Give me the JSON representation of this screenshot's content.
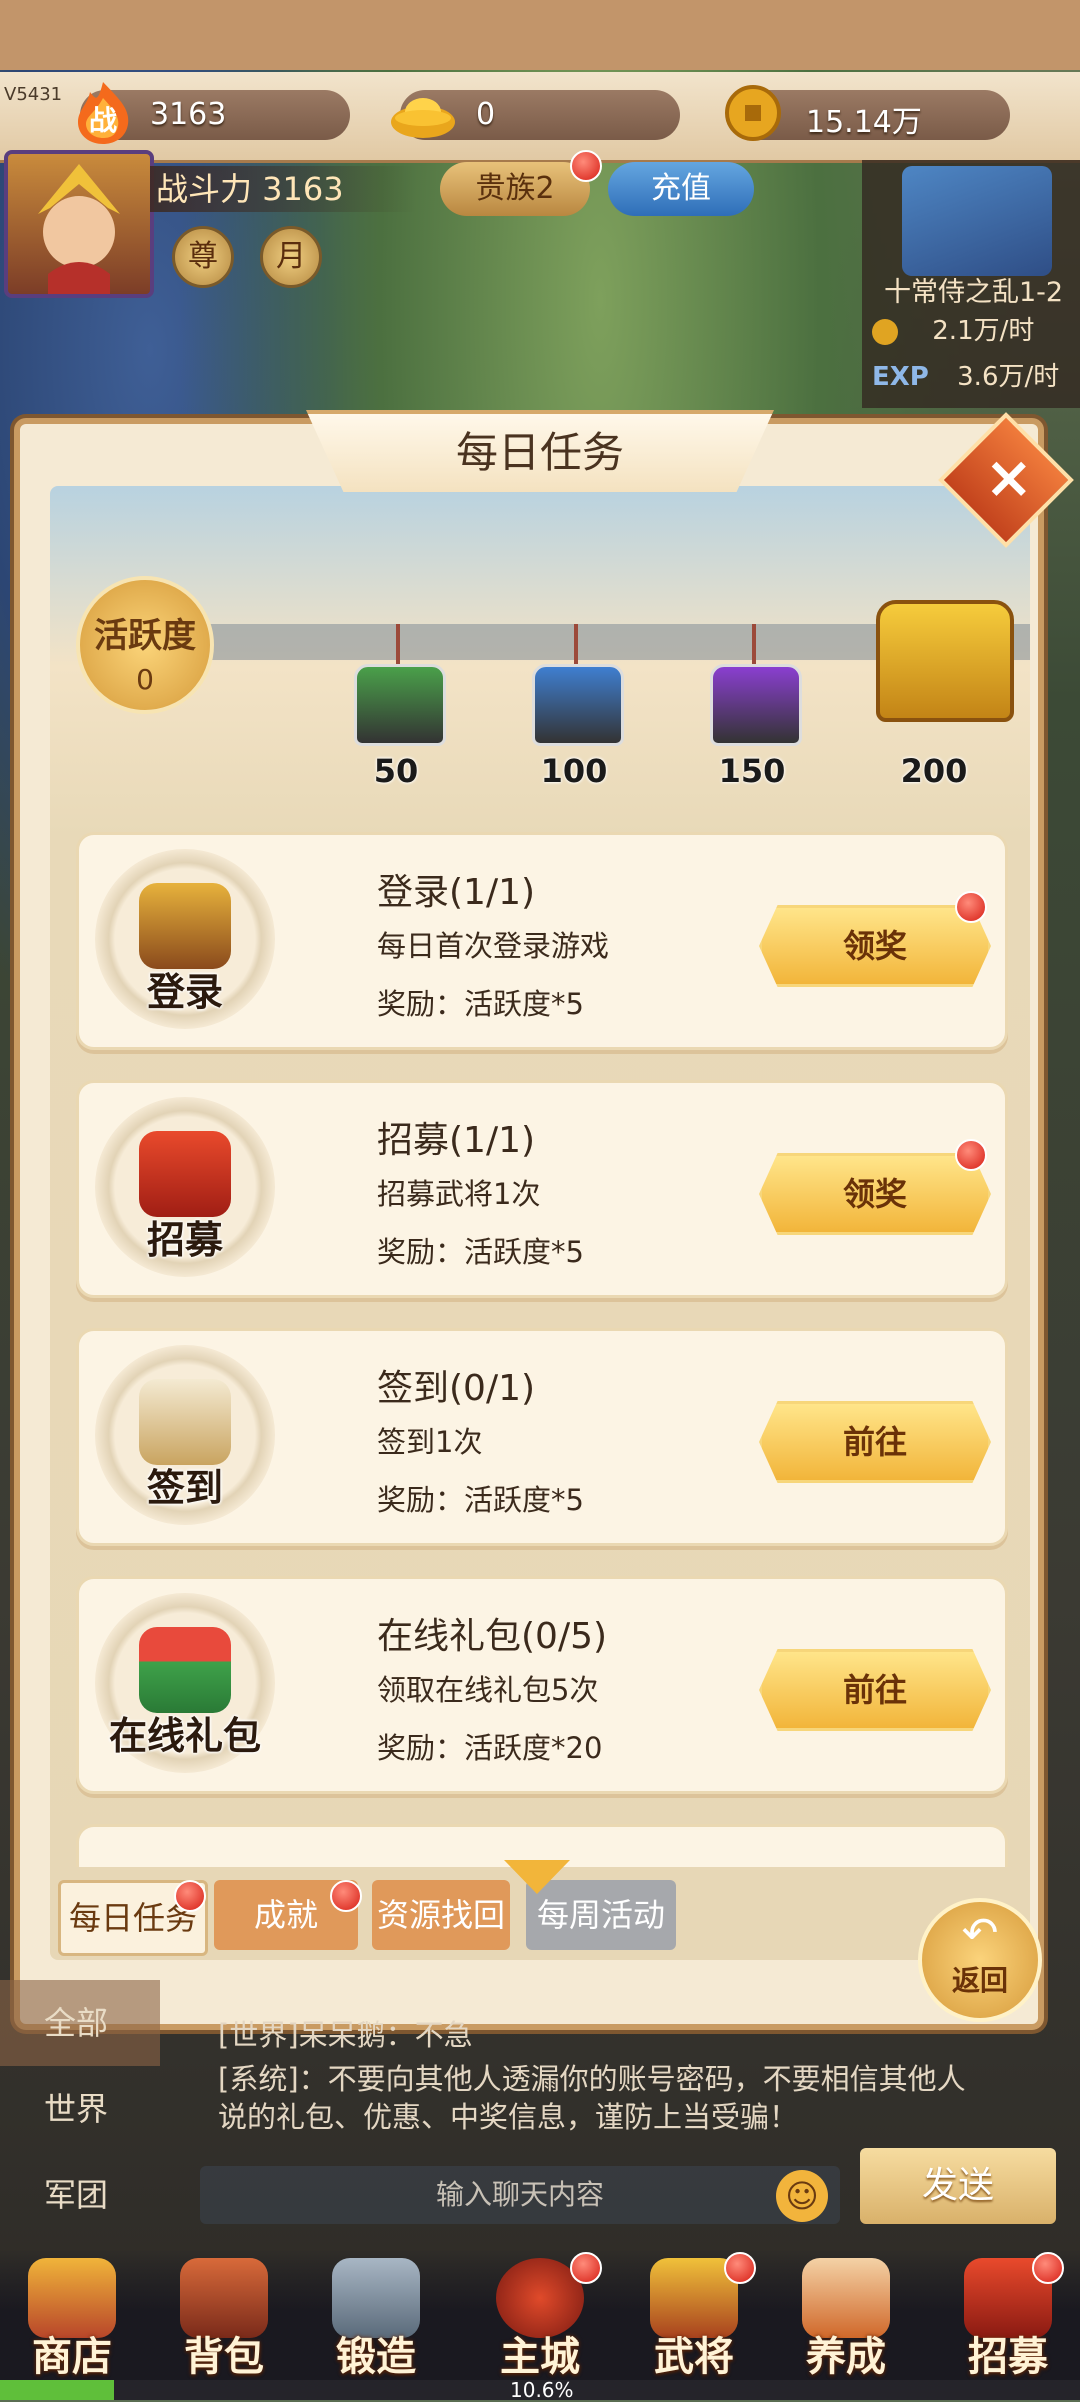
{
  "version": "V5431",
  "resources": {
    "power_icon_text": "战",
    "power": "3163",
    "gold_ingot": "0",
    "copper": "15.14万"
  },
  "player": {
    "combat_power": "战斗力 3163",
    "vip": "贵族2",
    "recharge": "充值",
    "btn_zun": "尊",
    "btn_yue": "月"
  },
  "stage": {
    "name": "十常侍之乱1-2",
    "coin_rate": "2.1万/时",
    "exp_label": "EXP",
    "exp_rate": "3.6万/时"
  },
  "popup": {
    "title": "每日任务",
    "close_label": "×",
    "activity_label": "活跃度",
    "activity_value": "0",
    "activity_progress": 0,
    "chests": [
      {
        "value": "50",
        "color": "#4aa04a"
      },
      {
        "value": "100",
        "color": "#3f7fd0"
      },
      {
        "value": "150",
        "color": "#8a3fd0"
      },
      {
        "value": "200",
        "color": "#e0a822"
      }
    ],
    "tasks": [
      {
        "icon_caption": "登录",
        "title": "登录(1/1)",
        "desc": "每日首次登录游戏",
        "reward": "奖励：活跃度*5",
        "button": "领奖",
        "has_dot": true
      },
      {
        "icon_caption": "招募",
        "title": "招募(1/1)",
        "desc": "招募武将1次",
        "reward": "奖励：活跃度*5",
        "button": "领奖",
        "has_dot": true
      },
      {
        "icon_caption": "签到",
        "title": "签到(0/1)",
        "desc": "签到1次",
        "reward": "奖励：活跃度*5",
        "button": "前往",
        "has_dot": false
      },
      {
        "icon_caption": "在线礼包",
        "title": "在线礼包(0/5)",
        "desc": "领取在线礼包5次",
        "reward": "奖励：活跃度*20",
        "button": "前往",
        "has_dot": false
      }
    ],
    "tabs": [
      {
        "label": "每日任务",
        "active": true
      },
      {
        "label": "成就",
        "active": false
      },
      {
        "label": "资源找回",
        "active": false
      },
      {
        "label": "每周活动",
        "active": false
      }
    ],
    "back_label": "返回"
  },
  "chat": {
    "channels": [
      "全部",
      "世界",
      "军团"
    ],
    "messages": [
      "[世界]呆呆鹅：不急",
      "[系统]：不要向其他人透漏你的账号密码，不要相信其他人说的礼包、优惠、中奖信息，谨防上当受骗！"
    ],
    "input_placeholder": "输入聊天内容",
    "send_label": "发送"
  },
  "nav": {
    "items": [
      "商店",
      "背包",
      "锻造",
      "主城",
      "武将",
      "养成",
      "招募"
    ],
    "progress_text": "10.6%",
    "progress": 0.106
  },
  "colors": {
    "accent_gold": "#f2b53a",
    "red_dot": "#d61d14"
  }
}
